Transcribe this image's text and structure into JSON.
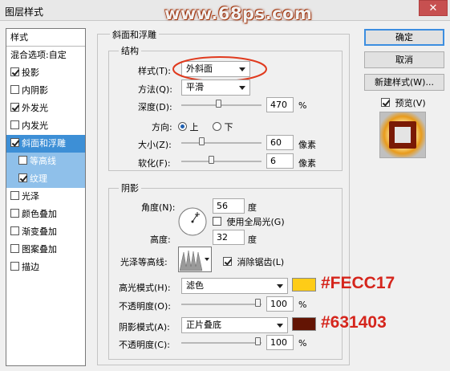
{
  "window": {
    "title": "图层样式",
    "watermark": "www.68ps.com",
    "close": "✕"
  },
  "styles_list": {
    "header": "样式",
    "items": [
      {
        "label": "混合选项:自定",
        "checkbox": false,
        "checked": false,
        "state": "normal"
      },
      {
        "label": "投影",
        "checkbox": true,
        "checked": true,
        "state": "normal"
      },
      {
        "label": "内阴影",
        "checkbox": true,
        "checked": false,
        "state": "normal"
      },
      {
        "label": "外发光",
        "checkbox": true,
        "checked": true,
        "state": "normal"
      },
      {
        "label": "内发光",
        "checkbox": true,
        "checked": false,
        "state": "normal"
      },
      {
        "label": "斜面和浮雕",
        "checkbox": true,
        "checked": true,
        "state": "selected"
      },
      {
        "label": "等高线",
        "checkbox": true,
        "checked": false,
        "state": "sub"
      },
      {
        "label": "纹理",
        "checkbox": true,
        "checked": true,
        "state": "sub"
      },
      {
        "label": "光泽",
        "checkbox": true,
        "checked": false,
        "state": "normal"
      },
      {
        "label": "颜色叠加",
        "checkbox": true,
        "checked": false,
        "state": "normal"
      },
      {
        "label": "渐变叠加",
        "checkbox": true,
        "checked": false,
        "state": "normal"
      },
      {
        "label": "图案叠加",
        "checkbox": true,
        "checked": false,
        "state": "normal"
      },
      {
        "label": "描边",
        "checkbox": true,
        "checked": false,
        "state": "normal"
      }
    ]
  },
  "bevel": {
    "group_title": "斜面和浮雕",
    "structure": {
      "title": "结构",
      "style_label": "样式(T):",
      "style_value": "外斜面",
      "technique_label": "方法(Q):",
      "technique_value": "平滑",
      "depth_label": "深度(D):",
      "depth_value": "470",
      "depth_unit": "%",
      "depth_slider": 0.47,
      "direction_label": "方向:",
      "direction_up": "上",
      "direction_down": "下",
      "size_label": "大小(Z):",
      "size_value": "60",
      "size_unit": "像素",
      "size_slider": 0.24,
      "soften_label": "软化(F):",
      "soften_value": "6",
      "soften_unit": "像素",
      "soften_slider": 0.37
    },
    "shading": {
      "title": "阴影",
      "angle_label": "角度(N):",
      "angle_value": "56",
      "angle_unit": "度",
      "global_light_label": "使用全局光(G)",
      "global_light_checked": false,
      "altitude_label": "高度:",
      "altitude_value": "32",
      "altitude_unit": "度",
      "gloss_contour_label": "光泽等高线:",
      "anti_alias_label": "消除锯齿(L)",
      "anti_alias_checked": true,
      "highlight_mode_label": "高光模式(H):",
      "highlight_mode_value": "滤色",
      "highlight_color": "#FECC17",
      "highlight_opacity_label": "不透明度(O):",
      "highlight_opacity_value": "100",
      "highlight_opacity_unit": "%",
      "highlight_opacity_slider": 1.0,
      "shadow_mode_label": "阴影模式(A):",
      "shadow_mode_value": "正片叠底",
      "shadow_color": "#631403",
      "shadow_opacity_label": "不透明度(C):",
      "shadow_opacity_value": "100",
      "shadow_opacity_unit": "%",
      "shadow_opacity_slider": 1.0
    }
  },
  "buttons": {
    "ok": "确定",
    "cancel": "取消",
    "new_style": "新建样式(W)...",
    "preview_label": "预览(V)",
    "preview_checked": true
  },
  "annotations": {
    "highlight_hex": "#FECC17",
    "shadow_hex": "#631403"
  }
}
